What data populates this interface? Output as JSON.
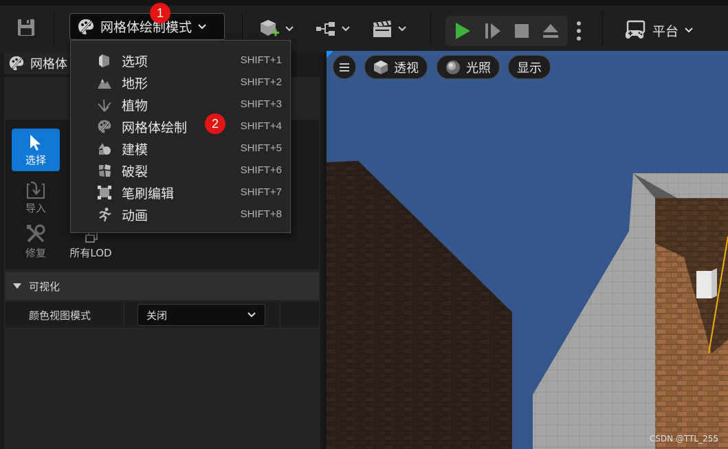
{
  "toolbar": {
    "mode_label": "网格体绘制模式",
    "platform_label": "平台"
  },
  "panel": {
    "tab_label": "网格体",
    "tools": {
      "select": "选择",
      "import": "导入",
      "repair": "修复",
      "all_lod": "所有LOD"
    },
    "section_title": "可视化",
    "property": {
      "label": "颜色视图模式",
      "value": "关闭"
    }
  },
  "viewport": {
    "perspective_label": "透视",
    "lighting_label": "光照",
    "show_label": "显示",
    "watermark": "CSDN @TTL_255"
  },
  "menu": {
    "items": [
      {
        "label": "选项",
        "shortcut": "SHIFT+1",
        "icon": "cube-half-icon"
      },
      {
        "label": "地形",
        "shortcut": "SHIFT+2",
        "icon": "mountain-icon"
      },
      {
        "label": "植物",
        "shortcut": "SHIFT+3",
        "icon": "grass-icon"
      },
      {
        "label": "网格体绘制",
        "shortcut": "SHIFT+4",
        "icon": "paint-palette-icon"
      },
      {
        "label": "建模",
        "shortcut": "SHIFT+5",
        "icon": "modeling-shapes-icon"
      },
      {
        "label": "破裂",
        "shortcut": "SHIFT+6",
        "icon": "fracture-icon"
      },
      {
        "label": "笔刷编辑",
        "shortcut": "SHIFT+7",
        "icon": "brush-edit-icon"
      },
      {
        "label": "动画",
        "shortcut": "SHIFT+8",
        "icon": "running-figure-icon"
      }
    ]
  },
  "annotations": {
    "badge_1": "1",
    "badge_2": "2"
  },
  "colors": {
    "accent": "#0f77d6",
    "play_green": "#3fb13f",
    "badge_red": "#e31414",
    "sky": "#34578c"
  }
}
